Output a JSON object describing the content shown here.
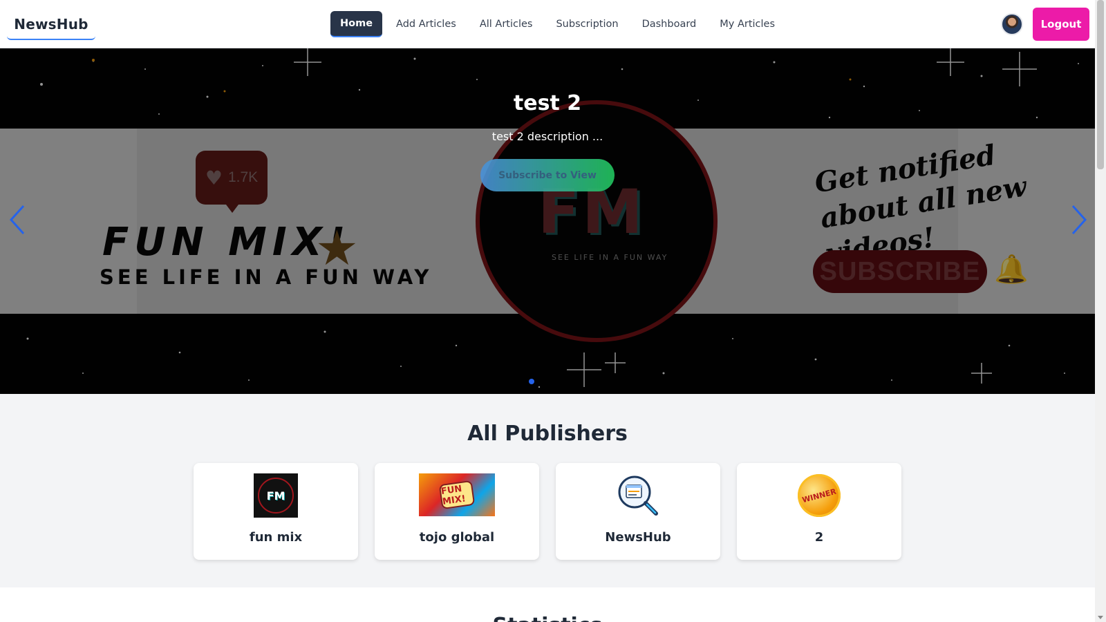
{
  "nav": {
    "brand": "NewsHub",
    "links": [
      "Home",
      "Add Articles",
      "All Articles",
      "Subscription",
      "Dashboard",
      "My Articles"
    ],
    "active": "Home",
    "logout_label": "Logout"
  },
  "hero": {
    "title": "test 2",
    "description": "test 2 description ...",
    "button_label": "Subscribe to View",
    "banner": {
      "likes": "1.7K",
      "fun_mix": "FUN MIX!",
      "fun_way": "SEE LIFE IN A FUN WAY",
      "fm": "FM",
      "fm_sub": "SEE LIFE IN A FUN WAY",
      "notified": "Get notified about all new videos!",
      "subscribe": "SUBSCRIBE"
    },
    "active_slide": 1
  },
  "publishers": {
    "title": "All Publishers",
    "items": [
      {
        "name": "fun mix",
        "logo": "fm-logo-icon"
      },
      {
        "name": "tojo global",
        "logo": "fun-mix-welcome-logo-icon"
      },
      {
        "name": "NewsHub",
        "logo": "magnifier-document-icon"
      },
      {
        "name": "2",
        "logo": "winner-badge-icon"
      }
    ],
    "logo_text": {
      "fm": "FM",
      "tojo": "FUN MIX!",
      "winner": "WINNER"
    }
  },
  "statistics": {
    "title": "Statistics"
  },
  "colors": {
    "logout": "#ec1ba8",
    "nav_active": "#283448",
    "accent_blue": "#3b82f6",
    "button_gradient_start": "#4a90d9",
    "button_gradient_end": "#22c55e"
  }
}
